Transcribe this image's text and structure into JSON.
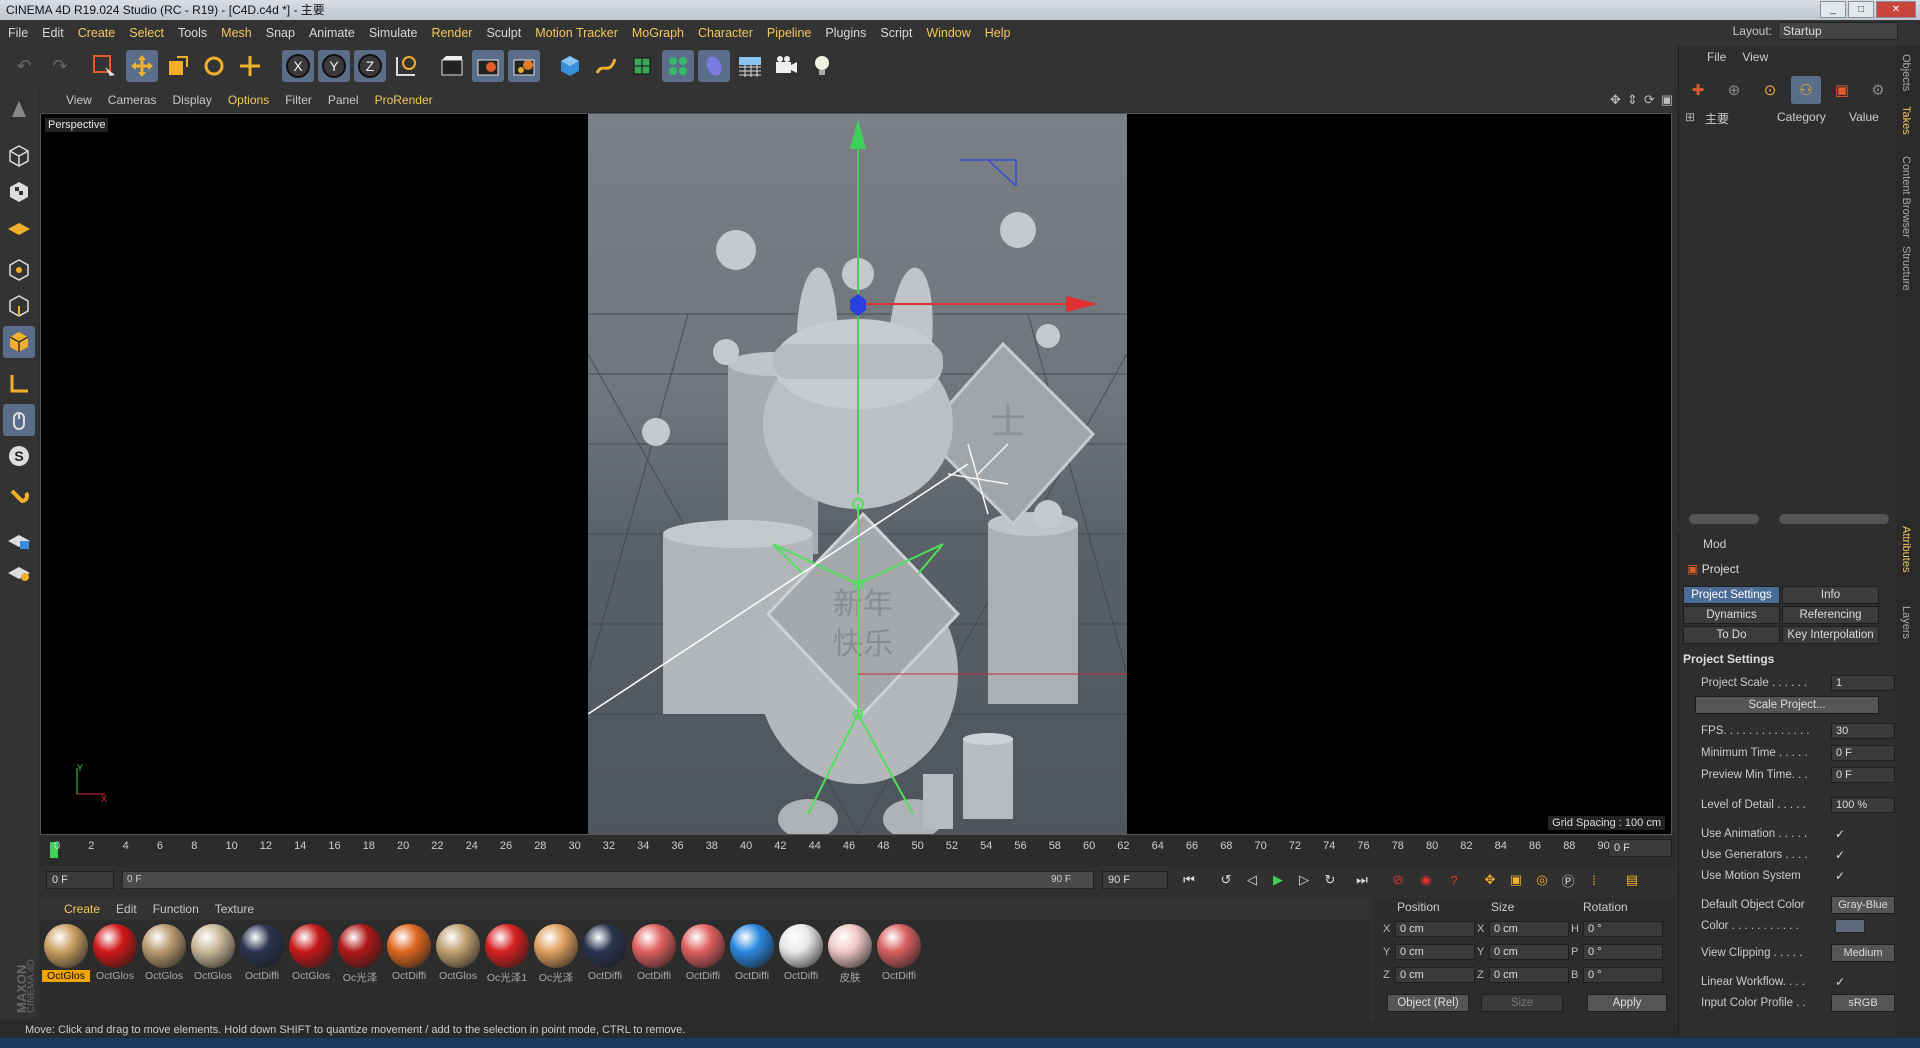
{
  "window": {
    "title": "CINEMA 4D R19.024 Studio (RC - R19) - [C4D.c4d *] - 主要",
    "buttons": [
      "_",
      "□",
      "✕"
    ]
  },
  "menubar": {
    "items": [
      {
        "label": "File"
      },
      {
        "label": "Edit"
      },
      {
        "label": "Create",
        "hl": true
      },
      {
        "label": "Select",
        "hl": true
      },
      {
        "label": "Tools"
      },
      {
        "label": "Mesh",
        "hl": true
      },
      {
        "label": "Snap"
      },
      {
        "label": "Animate"
      },
      {
        "label": "Simulate"
      },
      {
        "label": "Render",
        "hl": true
      },
      {
        "label": "Sculpt"
      },
      {
        "label": "Motion Tracker",
        "hl": true
      },
      {
        "label": "MoGraph",
        "hl": true
      },
      {
        "label": "Character",
        "hl": true
      },
      {
        "label": "Pipeline",
        "hl": true
      },
      {
        "label": "Plugins"
      },
      {
        "label": "Script"
      },
      {
        "label": "Window",
        "hl": true
      },
      {
        "label": "Help",
        "hl": true
      }
    ],
    "layout_label": "Layout:",
    "layout_value": "Startup"
  },
  "toolbar": {
    "icons": [
      "undo-icon",
      "redo-icon",
      "live-selection-icon",
      "move-icon",
      "scale-icon",
      "rotate-icon",
      "recent-tools-icon",
      "x-axis-icon",
      "y-axis-icon",
      "z-axis-icon",
      "world-coordinates-icon",
      "render-view-icon",
      "render-picture-viewer-icon",
      "edit-render-settings-icon",
      "cube-icon",
      "pen-icon",
      "subdivision-icon",
      "cloner-icon",
      "deformer-icon",
      "floor-icon",
      "camera-icon",
      "light-icon"
    ],
    "axis_x": "X",
    "axis_y": "Y",
    "axis_z": "Z"
  },
  "lefttools": {
    "icons": [
      "make-editable-icon",
      "model-mode-icon",
      "texture-mode-icon",
      "workplane-mode-icon",
      "points-mode-icon",
      "edges-mode-icon",
      "polygons-mode-icon",
      "axis-mode-icon",
      "tweak-mode-icon",
      "solo-icon",
      "snap-icon",
      "locked-workplane-icon",
      "planar-workplane-icon"
    ],
    "solo_glyph": "S"
  },
  "viewport": {
    "menu": [
      {
        "label": "View"
      },
      {
        "label": "Cameras"
      },
      {
        "label": "Display"
      },
      {
        "label": "Options",
        "hl": true
      },
      {
        "label": "Filter"
      },
      {
        "label": "Panel"
      },
      {
        "label": "ProRender",
        "hl": true
      }
    ],
    "camera_label": "Perspective",
    "grid_spacing": "Grid Spacing : 100 cm",
    "axis_y": "Y",
    "axis_x": "X",
    "sign_text_top": "士",
    "sign_text_main": "新年",
    "sign_text_sub": "快乐"
  },
  "timeline": {
    "ticks": [
      "0",
      "2",
      "4",
      "6",
      "8",
      "10",
      "12",
      "14",
      "16",
      "18",
      "20",
      "22",
      "24",
      "26",
      "28",
      "30",
      "32",
      "34",
      "36",
      "38",
      "40",
      "42",
      "44",
      "46",
      "48",
      "50",
      "52",
      "54",
      "56",
      "58",
      "60",
      "62",
      "64",
      "66",
      "68",
      "70",
      "72",
      "74",
      "76",
      "78",
      "80",
      "82",
      "84",
      "86",
      "88",
      "90"
    ],
    "current_frame": "0 F"
  },
  "transport": {
    "start_frame": "0 F",
    "range_start": "0 F",
    "range_end": "90 F",
    "end_frame": "90 F"
  },
  "materials": {
    "menu": [
      {
        "label": "Create",
        "hl": true
      },
      {
        "label": "Edit"
      },
      {
        "label": "Function"
      },
      {
        "label": "Texture"
      }
    ],
    "items": [
      {
        "label": "OctGlos",
        "color": "#c9a060",
        "selected": true
      },
      {
        "label": "OctGlos",
        "color": "#d01818"
      },
      {
        "label": "OctGlos",
        "color": "#b89a70"
      },
      {
        "label": "OctGlos",
        "color": "#c8b898"
      },
      {
        "label": "OctDiffi",
        "color": "#2a3450"
      },
      {
        "label": "OctGlos",
        "color": "#c81818"
      },
      {
        "label": "Oc光泽",
        "color": "#b01818"
      },
      {
        "label": "OctDiffi",
        "color": "#e06820"
      },
      {
        "label": "OctGlos",
        "color": "#c0a070"
      },
      {
        "label": "Oc光泽1",
        "color": "#d82020"
      },
      {
        "label": "Oc光泽",
        "color": "#e0a060"
      },
      {
        "label": "OctDiffi",
        "color": "#2a3450"
      },
      {
        "label": "OctDiffi",
        "color": "#e06060"
      },
      {
        "label": "OctDiffi",
        "color": "#e06060"
      },
      {
        "label": "OctDiffi",
        "color": "#2a88e0"
      },
      {
        "label": "OctDiffi",
        "color": "#e8e8e8"
      },
      {
        "label": "皮肤",
        "color": "#f0c8c8"
      },
      {
        "label": "OctDiffi",
        "color": "#d86060"
      }
    ]
  },
  "coords": {
    "position_label": "Position",
    "size_label": "Size",
    "rotation_label": "Rotation",
    "rows": [
      {
        "pa": "X",
        "pv": "0 cm",
        "sa": "X",
        "sv": "0 cm",
        "ra": "H",
        "rv": "0 °"
      },
      {
        "pa": "Y",
        "pv": "0 cm",
        "sa": "Y",
        "sv": "0 cm",
        "ra": "P",
        "rv": "0 °"
      },
      {
        "pa": "Z",
        "pv": "0 cm",
        "sa": "Z",
        "sv": "0 cm",
        "ra": "B",
        "rv": "0 °"
      }
    ],
    "mode_select": "Object (Rel)",
    "size_select": "Size",
    "apply_label": "Apply"
  },
  "status": "Move: Click and drag to move elements. Hold down SHIFT to quantize movement / add to the selection in point mode, CTRL to remove.",
  "objects_panel": {
    "menu": [
      {
        "label": "File"
      },
      {
        "label": "View"
      }
    ],
    "take_name": "主要",
    "col_category": "Category",
    "col_value": "Value"
  },
  "attributes": {
    "menu_label": "Mod",
    "title": "Project",
    "tabs": [
      {
        "label": "Project Settings",
        "active": true
      },
      {
        "label": "Info"
      },
      {
        "label": "Dynamics"
      },
      {
        "label": "Referencing"
      },
      {
        "label": "To Do"
      },
      {
        "label": "Key Interpolation"
      }
    ],
    "section": "Project Settings",
    "project_scale_label": "Project Scale . . . . . .",
    "project_scale_value": "1",
    "scale_project_button": "Scale Project...",
    "fps_label": "FPS. . . . . . . . . . . . . .",
    "fps_value": "30",
    "min_time_label": "Minimum Time . . . . .",
    "min_time_value": "0 F",
    "preview_min_label": "Preview Min Time. . .",
    "preview_min_value": "0 F",
    "lod_label": "Level of Detail . . . . .",
    "lod_value": "100 %",
    "use_animation_label": "Use Animation . . . . .",
    "use_generators_label": "Use Generators . . . .",
    "use_motion_label": "Use Motion System",
    "default_color_label": "Default Object Color",
    "default_color_value": "Gray-Blue",
    "color_label": "Color . . . . . . . . . . .",
    "view_clipping_label": "View Clipping . . . . .",
    "view_clipping_value": "Medium",
    "linear_workflow_label": "Linear Workflow. . . .",
    "input_profile_label": "Input Color Profile . .",
    "input_profile_value": "sRGB",
    "check_glyph": "✓"
  },
  "side_tabs": [
    {
      "label": "Objects"
    },
    {
      "label": "Takes",
      "hl": true
    },
    {
      "label": "Content Browser"
    },
    {
      "label": "Structure"
    },
    {
      "label": "Attributes",
      "hl": true
    },
    {
      "label": "Layers"
    }
  ]
}
